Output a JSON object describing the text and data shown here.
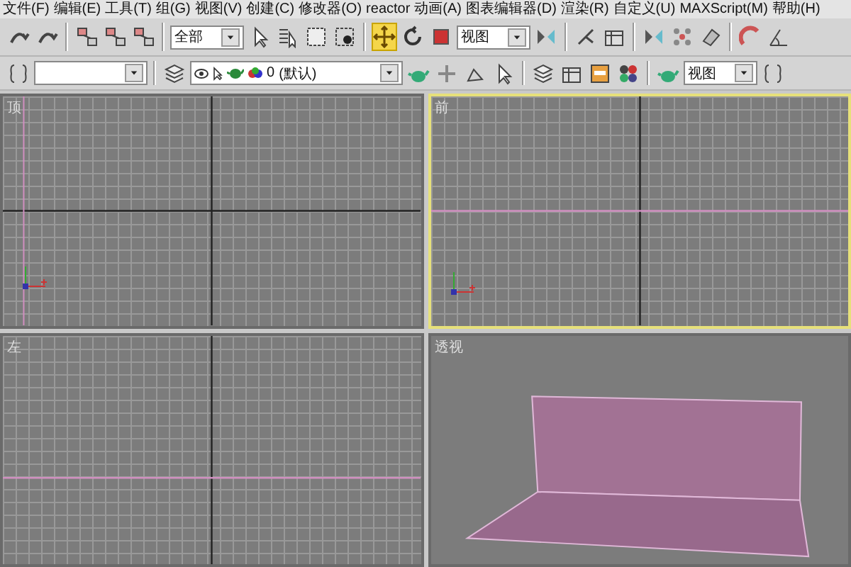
{
  "menu_bar": [
    "文件(F)",
    "编辑(E)",
    "工具(T)",
    "组(G)",
    "视图(V)",
    "创建(C)",
    "修改器(O)",
    "reactor",
    "动画(A)",
    "图表编辑器(D)",
    "渲染(R)",
    "自定义(U)",
    "MAXScript(M)",
    "帮助(H)"
  ],
  "main_toolbar": [
    {
      "kind": "tool",
      "selected": false
    },
    {
      "kind": "tool",
      "selected": false
    },
    {
      "kind": "separator"
    },
    {
      "kind": "tool",
      "selected": false
    },
    {
      "kind": "tool",
      "selected": false
    },
    {
      "kind": "tool",
      "selected": false
    },
    {
      "kind": "separator"
    },
    {
      "kind": "dropdown",
      "value": "全部"
    },
    {
      "kind": "tool",
      "selected": false
    },
    {
      "kind": "tool",
      "selected": false
    },
    {
      "kind": "tool",
      "selected": false
    },
    {
      "kind": "tool",
      "selected": false
    },
    {
      "kind": "separator"
    },
    {
      "kind": "tool",
      "selected": true
    },
    {
      "kind": "tool",
      "selected": false
    },
    {
      "kind": "tool",
      "selected": false
    },
    {
      "kind": "dropdown",
      "value": "视图"
    },
    {
      "kind": "tool",
      "selected": false
    },
    {
      "kind": "separator"
    },
    {
      "kind": "tool",
      "selected": false
    },
    {
      "kind": "tool",
      "selected": false
    },
    {
      "kind": "separator"
    },
    {
      "kind": "tool",
      "selected": false
    },
    {
      "kind": "tool",
      "selected": false
    },
    {
      "kind": "tool",
      "selected": false
    },
    {
      "kind": "separator"
    },
    {
      "kind": "tool",
      "selected": false
    },
    {
      "kind": "tool",
      "selected": false
    }
  ],
  "secondary_toolbar": [
    {
      "kind": "tool",
      "selected": false
    },
    {
      "kind": "dropdown"
    },
    {
      "kind": "separator"
    },
    {
      "kind": "tool",
      "selected": false
    },
    {
      "kind": "layer_dropdown",
      "layer": "0",
      "value": "(默认)"
    },
    {
      "kind": "tool",
      "selected": false
    },
    {
      "kind": "tool",
      "selected": false
    },
    {
      "kind": "tool",
      "selected": false
    },
    {
      "kind": "tool",
      "selected": false
    },
    {
      "kind": "separator"
    },
    {
      "kind": "tool",
      "selected": false
    },
    {
      "kind": "tool",
      "selected": false
    },
    {
      "kind": "tool",
      "selected": false
    },
    {
      "kind": "tool",
      "selected": false
    },
    {
      "kind": "separator"
    },
    {
      "kind": "tool",
      "selected": false
    },
    {
      "kind": "dropdown",
      "value": "视图"
    },
    {
      "kind": "tool",
      "selected": false
    }
  ],
  "viewports": [
    {
      "label": "顶",
      "kind": "ortho",
      "selected": false,
      "gizmo": true
    },
    {
      "label": "前",
      "kind": "ortho",
      "selected": true,
      "gizmo": true
    },
    {
      "label": "左",
      "kind": "ortho",
      "selected": false,
      "gizmo": false
    },
    {
      "label": "透视",
      "kind": "perspective",
      "selected": false,
      "gizmo": false
    }
  ]
}
